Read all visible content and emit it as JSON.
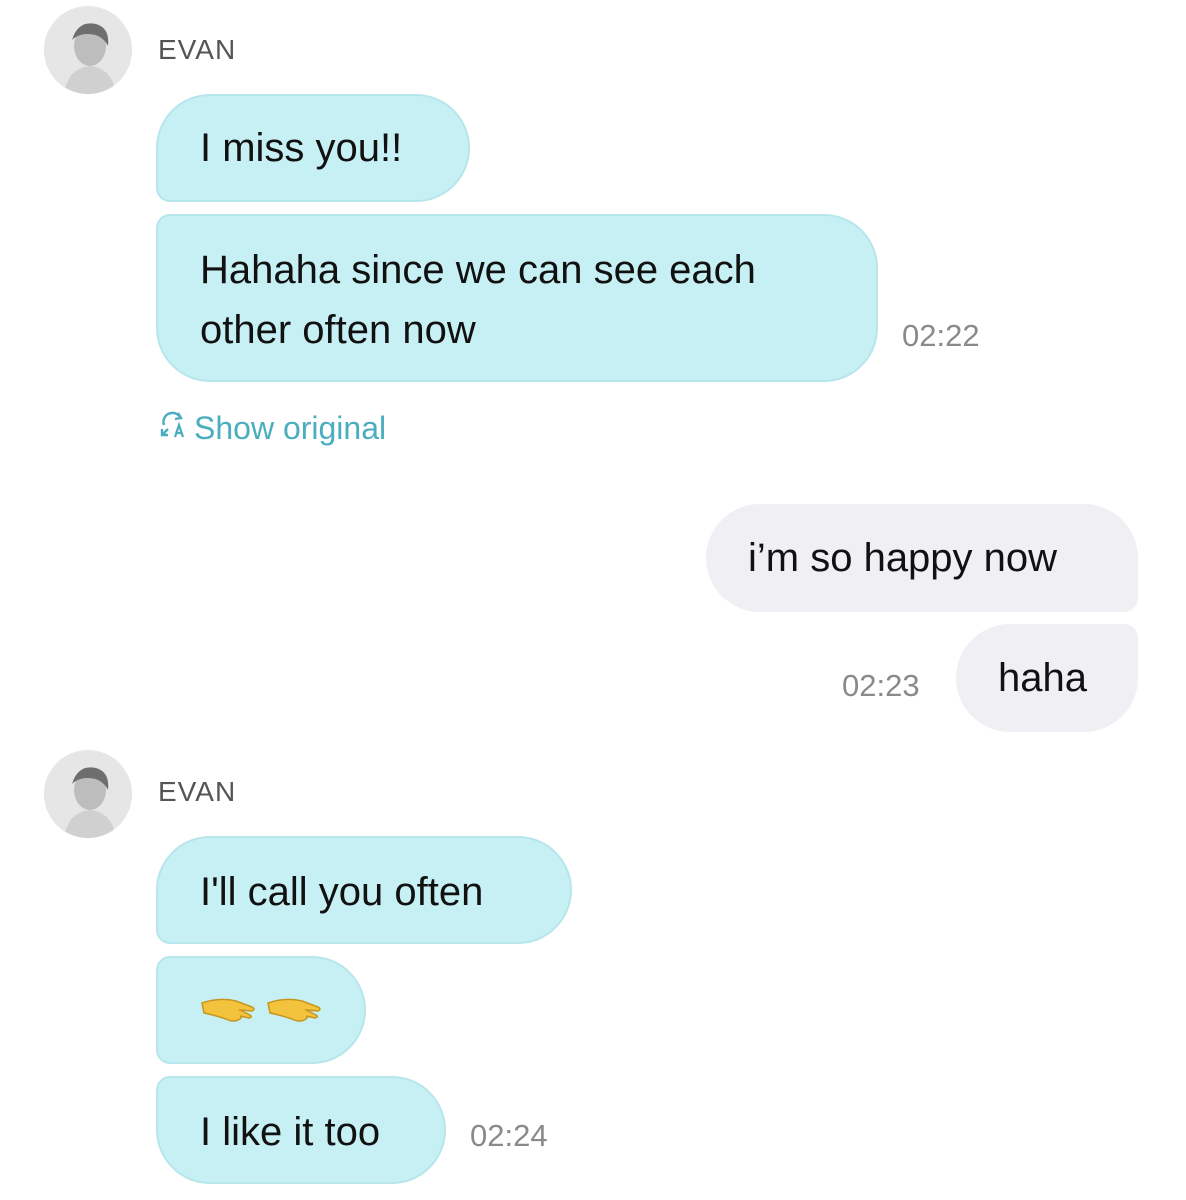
{
  "groups": [
    {
      "sender": "EVAN"
    },
    {
      "sender": "EVAN"
    }
  ],
  "messages": {
    "m1": "I miss you!!",
    "m2_line1": "Hahaha since we can see each",
    "m2_line2": "other often now",
    "m3": "i’m so happy now",
    "m4": "haha",
    "m5": "I'll call you often",
    "m7": "I like it too"
  },
  "emoji": {
    "m6": [
      "pinching-hand-icon",
      "pinching-hand-icon"
    ]
  },
  "times": {
    "t1": "02:22",
    "t2": "02:23",
    "t3": "02:24"
  },
  "show_original": "Show original",
  "colors": {
    "incoming_bubble": "#c7f0f4",
    "outgoing_bubble": "#f0f0f4",
    "accent": "#4aaebf"
  }
}
